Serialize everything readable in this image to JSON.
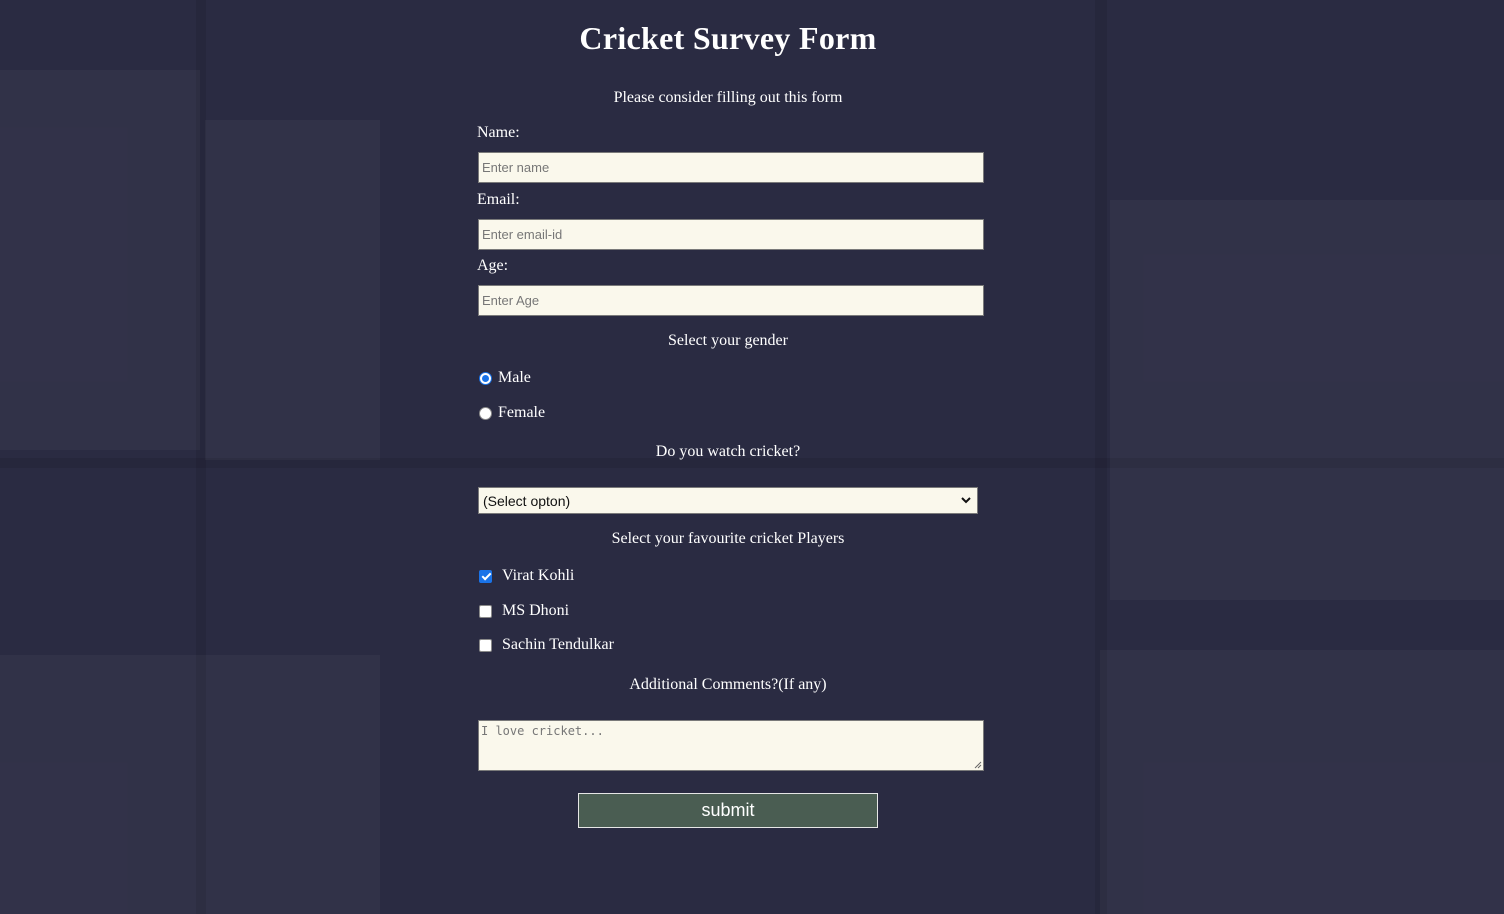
{
  "form": {
    "title": "Cricket Survey Form",
    "description": "Please consider filling out this form",
    "name_label": "Name:",
    "name_placeholder": "Enter name",
    "email_label": "Email:",
    "email_placeholder": "Enter email-id",
    "age_label": "Age:",
    "age_placeholder": "Enter Age",
    "gender_heading": "Select your gender",
    "gender_options": [
      {
        "label": "Male",
        "checked": true
      },
      {
        "label": "Female",
        "checked": false
      }
    ],
    "watch_heading": "Do you watch cricket?",
    "watch_selected": "(Select opton)",
    "players_heading": "Select your favourite cricket Players",
    "players": [
      {
        "label": "Virat Kohli",
        "checked": true
      },
      {
        "label": "MS Dhoni",
        "checked": false
      },
      {
        "label": "Sachin Tendulkar",
        "checked": false
      }
    ],
    "comments_heading": "Additional Comments?(If any)",
    "comments_placeholder": "I love cricket...",
    "submit_label": "submit"
  },
  "colors": {
    "background": "#2a2b42",
    "input_background": "#faf8ec",
    "submit_background": "#4a5d52",
    "accent": "#1a73e8"
  },
  "icons": {
    "select_arrow": "chevron-down-icon",
    "check_mark": "check-icon"
  }
}
